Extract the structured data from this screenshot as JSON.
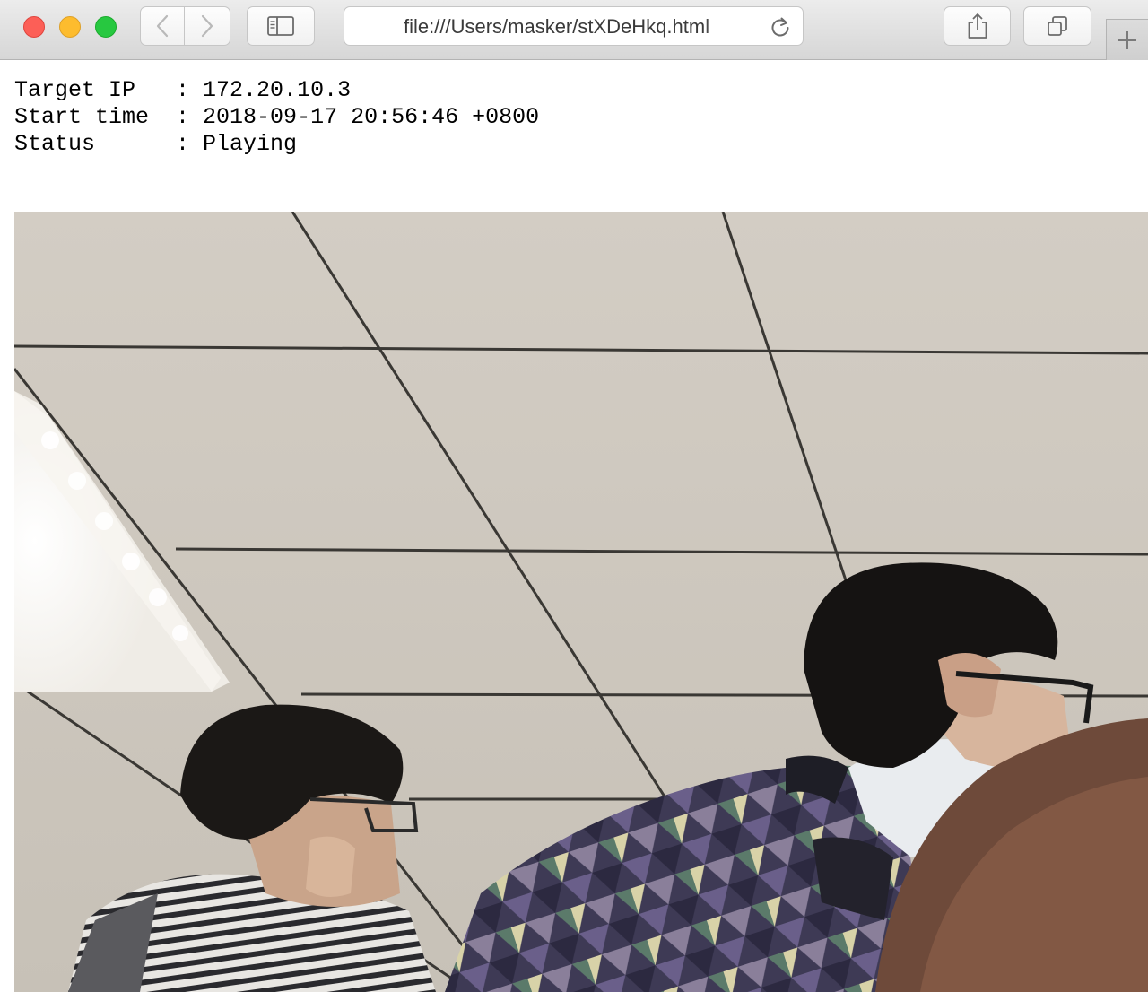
{
  "browser": {
    "url": "file:///Users/masker/stXDeHkq.html",
    "buttons": {
      "back": "chevron-left-icon",
      "forward": "chevron-right-icon",
      "sidebar": "sidebar-icon",
      "reload": "reload-icon",
      "share": "share-icon",
      "tabs": "tabs-overview-icon",
      "new_tab": "plus-icon"
    },
    "traffic_lights": {
      "close": "#fc5f57",
      "minimize": "#fdbc2e",
      "zoom": "#27c840"
    }
  },
  "info": {
    "target_ip": {
      "label": "Target IP  ",
      "sep": " : ",
      "value": "172.20.10.3"
    },
    "start_time": {
      "label": "Start time ",
      "sep": " : ",
      "value": "2018-09-17 20:56:46 +0800"
    },
    "status": {
      "label": "Status     ",
      "sep": " : ",
      "value": "Playing"
    }
  }
}
